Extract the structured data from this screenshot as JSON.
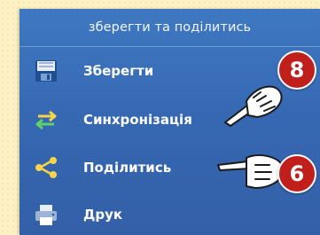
{
  "panel": {
    "header_title": "зберегти та поділитись",
    "items": [
      {
        "label": "Зберегти",
        "icon": "floppy-disk-icon"
      },
      {
        "label": "Синхронізація",
        "icon": "sync-arrows-icon"
      },
      {
        "label": "Поділитись",
        "icon": "share-icon"
      },
      {
        "label": "Друк",
        "icon": "printer-icon"
      }
    ]
  },
  "callouts": [
    {
      "number": "8",
      "points_to": "Синхронізація"
    },
    {
      "number": "6",
      "points_to": "Поділитись"
    }
  ],
  "colors": {
    "panel_blue": "#3a6db6",
    "badge_red": "#c11f1b",
    "background": "#fdf2c4"
  }
}
